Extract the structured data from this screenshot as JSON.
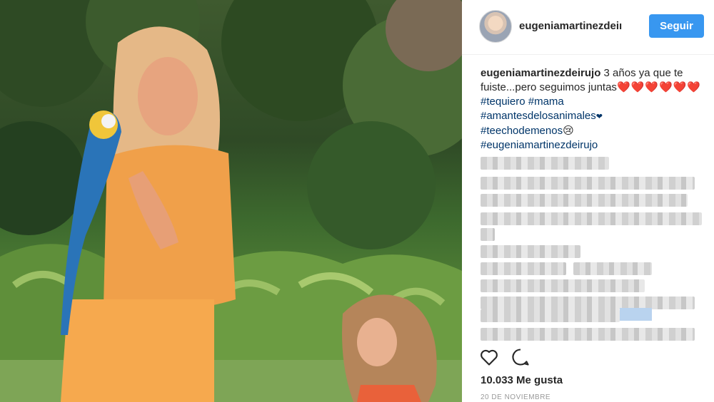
{
  "post": {
    "username": "eugeniamartinezdeirujo",
    "username_header": "eugeniamartinezdeiı",
    "follow_label": "Seguir",
    "caption": {
      "user": "eugeniamartinezdeirujo",
      "text": "3 años ya que te fuiste...pero seguimos juntas",
      "hearts": "❤️❤️❤️❤️❤️❤️",
      "tag_tequiero": "#tequiero",
      "tag_mama": "#mama",
      "tag_amantes": "#amantesdelosanimales",
      "small_heart": "❤",
      "tag_teecho": "#teechodemenos",
      "cry_emoji": "😢",
      "tag_eugenia": "#eugeniamartinezdeirujo"
    },
    "likes": "10.033 Me gusta",
    "date": "20 DE NOVIEMBRE"
  },
  "icons": {
    "like": "heart-outline-icon",
    "comment": "speech-bubble-icon"
  },
  "colors": {
    "follow_bg": "#3897f0",
    "hashtag": "#003569",
    "text": "#262626",
    "date": "#999999"
  }
}
